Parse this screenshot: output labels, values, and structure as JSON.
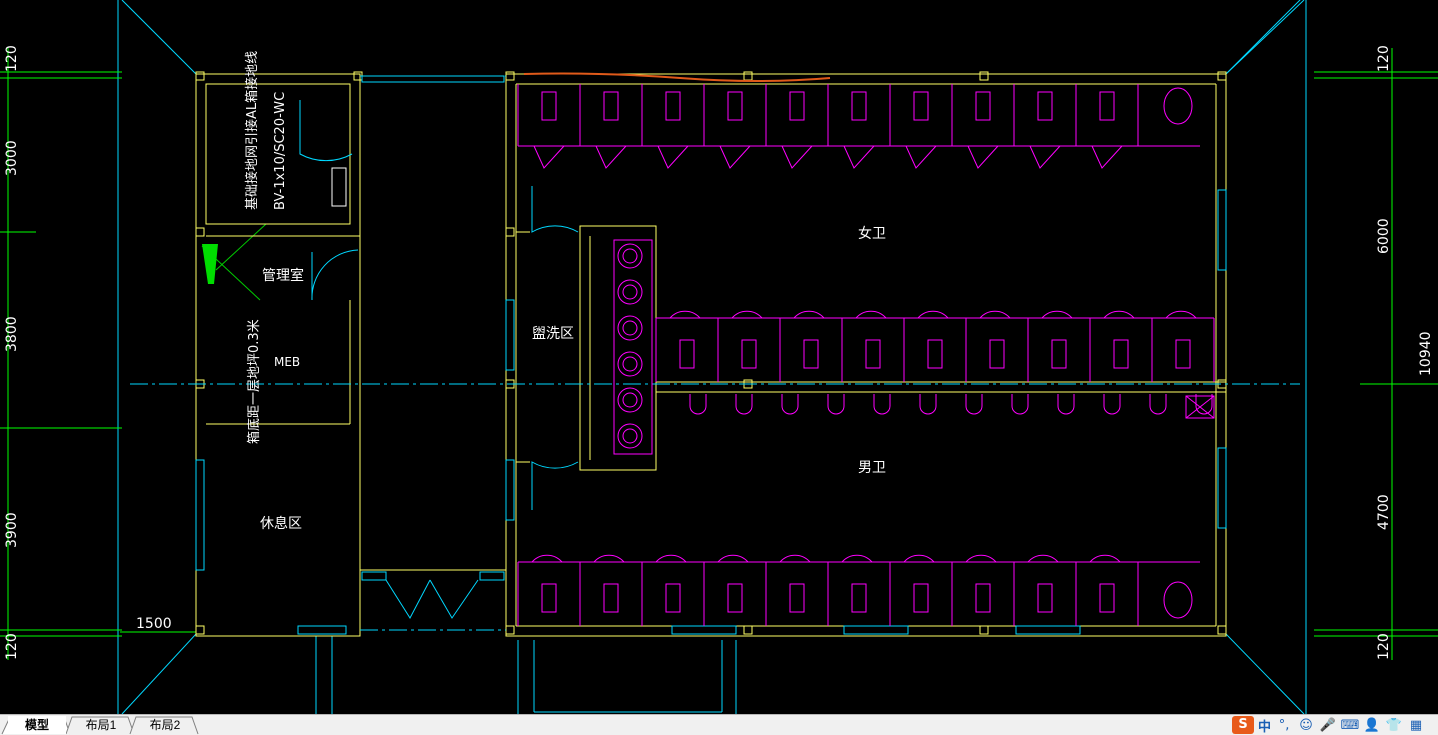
{
  "app": {
    "name": "CAD drawing viewer"
  },
  "tabs": [
    {
      "label": "模型",
      "active": true
    },
    {
      "label": "布局1",
      "active": false
    },
    {
      "label": "布局2",
      "active": false
    }
  ],
  "ime": {
    "logo": "S",
    "lang": "中",
    "punct": "°,",
    "icons": [
      "smiley-icon",
      "microphone-icon",
      "keyboard-icon",
      "user-icon",
      "shirt-icon",
      "grid-icon"
    ]
  },
  "colors": {
    "background": "#000000",
    "wall": "#ffff66",
    "fixture": "#ff00ff",
    "dimension": "#00ff00",
    "aux": "#00ffff",
    "note": "#ffffff",
    "redline": "#e05a1a"
  },
  "dimensions": {
    "left": [
      "120",
      "3000",
      "3800",
      "3900",
      "120"
    ],
    "right": [
      "120",
      "6000",
      "10940",
      "4700",
      "120"
    ],
    "bottom": "1500"
  },
  "rooms": {
    "female": "女卫",
    "male": "男卫",
    "wash": "盥洗区",
    "management": "管理室",
    "rest": "休息区",
    "meb": "MEB"
  },
  "notes": {
    "note1": "基础接地网引接AL箱接地线",
    "note2": "BV-1x10/SC20-WC",
    "note3": "箱底距一层地坪0.3米"
  }
}
